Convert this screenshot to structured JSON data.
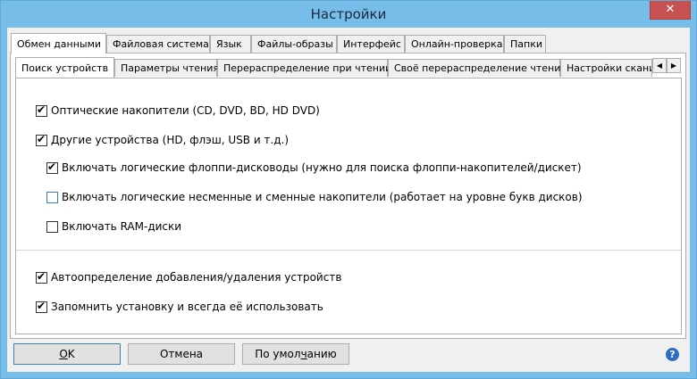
{
  "window": {
    "title": "Настройки",
    "close_glyph": "✕"
  },
  "outer_tabs": [
    {
      "label": "Обмен данными",
      "selected": true
    },
    {
      "label": "Файловая система"
    },
    {
      "label": "Язык"
    },
    {
      "label": "Файлы-образы"
    },
    {
      "label": "Интерфейс"
    },
    {
      "label": "Онлайн-проверка"
    },
    {
      "label": "Папки"
    }
  ],
  "inner_tabs": [
    {
      "label": "Поиск устройств",
      "selected": true
    },
    {
      "label": "Параметры чтения"
    },
    {
      "label": "Перераспределение при чтении"
    },
    {
      "label": "Своё перераспределение чтения"
    },
    {
      "label": "Настройки скани"
    }
  ],
  "scroll": {
    "left_glyph": "◀",
    "right_glyph": "▶"
  },
  "options": {
    "optical": {
      "label": "Оптические накопители (CD, DVD, BD, HD DVD)",
      "checked": true
    },
    "other": {
      "label": "Другие устройства (HD, флэш, USB и т.д.)",
      "checked": true
    },
    "floppy": {
      "label": "Включать логические флоппи-дисководы (нужно для поиска флоппи-накопителей/дискет)",
      "checked": true
    },
    "fixed_removable": {
      "label": "Включать логические несменные и сменные накопители (работает на уровне букв дисков)",
      "checked": false
    },
    "ramdisk": {
      "label": "Включать RAM-диски",
      "checked": false
    },
    "autodetect": {
      "label": "Автоопределение добавления/удаления устройств",
      "checked": true
    },
    "remember": {
      "label": "Запомнить установку и всегда её использовать",
      "checked": true
    }
  },
  "buttons": {
    "ok": {
      "prefix": "",
      "accel": "O",
      "suffix": "K"
    },
    "cancel": {
      "label": "Отмена"
    },
    "defaults": {
      "prefix": "По умол",
      "accel": "ч",
      "suffix": "анию"
    }
  },
  "help": {
    "glyph": "?"
  }
}
